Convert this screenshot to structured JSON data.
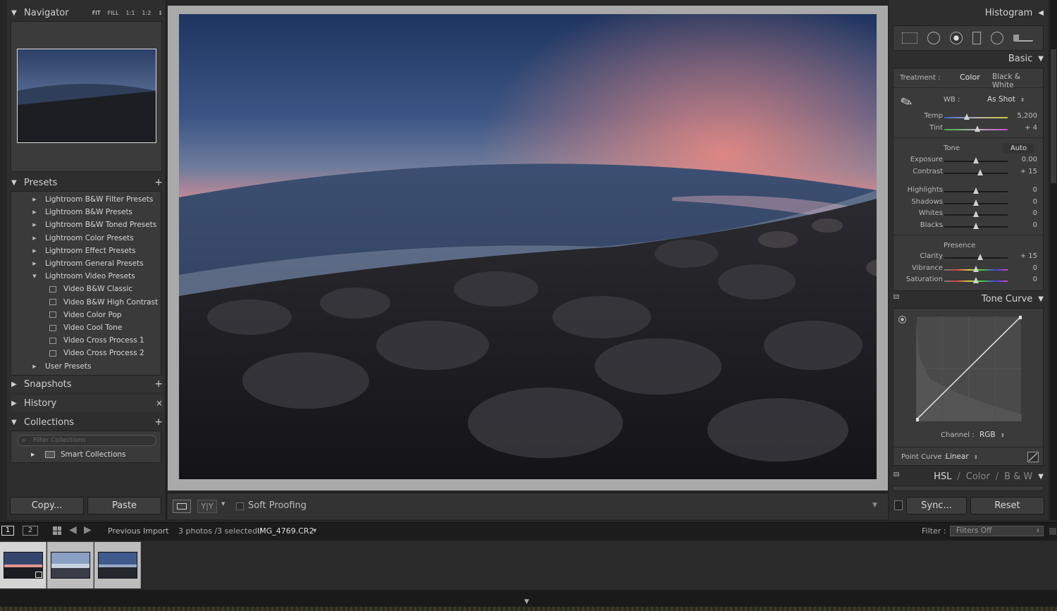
{
  "navigator": {
    "title": "Navigator",
    "zoom_options": [
      "FIT",
      "FILL",
      "1:1",
      "1:2"
    ]
  },
  "presets": {
    "title": "Presets",
    "items": [
      {
        "label": "Lightroom B&W Filter Presets",
        "type": "folder",
        "open": false
      },
      {
        "label": "Lightroom B&W Presets",
        "type": "folder",
        "open": false
      },
      {
        "label": "Lightroom B&W Toned Presets",
        "type": "folder",
        "open": false
      },
      {
        "label": "Lightroom Color Presets",
        "type": "folder",
        "open": false
      },
      {
        "label": "Lightroom Effect Presets",
        "type": "folder",
        "open": false
      },
      {
        "label": "Lightroom General Presets",
        "type": "folder",
        "open": false
      },
      {
        "label": "Lightroom Video Presets",
        "type": "folder",
        "open": true
      },
      {
        "label": "Video B&W Classic",
        "type": "preset"
      },
      {
        "label": "Video B&W High Contrast",
        "type": "preset"
      },
      {
        "label": "Video Color Pop",
        "type": "preset"
      },
      {
        "label": "Video Cool Tone",
        "type": "preset"
      },
      {
        "label": "Video Cross Process 1",
        "type": "preset"
      },
      {
        "label": "Video Cross Process 2",
        "type": "preset"
      },
      {
        "label": "User Presets",
        "type": "folder",
        "open": false
      }
    ]
  },
  "snapshots": {
    "title": "Snapshots"
  },
  "history": {
    "title": "History"
  },
  "collections": {
    "title": "Collections",
    "filter_placeholder": "Filter Collections",
    "smart": "Smart Collections"
  },
  "left_buttons": {
    "copy": "Copy...",
    "paste": "Paste"
  },
  "toolbar": {
    "soft_proofing": "Soft Proofing"
  },
  "histogram": {
    "title": "Histogram"
  },
  "basic": {
    "title": "Basic",
    "treatment_label": "Treatment :",
    "treatment_color": "Color",
    "treatment_bw": "Black & White",
    "wb_label": "WB :",
    "wb_value": "As Shot",
    "tone_label": "Tone",
    "auto": "Auto",
    "presence_label": "Presence",
    "sliders_wb": [
      {
        "label": "Temp",
        "value": "5,200",
        "pos": 0.35
      },
      {
        "label": "Tint",
        "value": "+ 4",
        "pos": 0.52
      }
    ],
    "sliders_tone": [
      {
        "label": "Exposure",
        "value": "0.00",
        "pos": 0.5
      },
      {
        "label": "Contrast",
        "value": "+ 15",
        "pos": 0.57
      }
    ],
    "sliders_tone2": [
      {
        "label": "Highlights",
        "value": "0",
        "pos": 0.5
      },
      {
        "label": "Shadows",
        "value": "0",
        "pos": 0.5
      },
      {
        "label": "Whites",
        "value": "0",
        "pos": 0.5
      },
      {
        "label": "Blacks",
        "value": "0",
        "pos": 0.5
      }
    ],
    "sliders_presence": [
      {
        "label": "Clarity",
        "value": "+ 15",
        "pos": 0.57
      },
      {
        "label": "Vibrance",
        "value": "0",
        "pos": 0.5
      },
      {
        "label": "Saturation",
        "value": "0",
        "pos": 0.5
      }
    ]
  },
  "tone_curve": {
    "title": "Tone Curve",
    "channel_label": "Channel :",
    "channel_value": "RGB",
    "point_curve_label": "Point Curve :",
    "point_curve_value": "Linear"
  },
  "hsl": {
    "hsl": "HSL",
    "sep": "/",
    "color": "Color",
    "bw": "B & W"
  },
  "right_buttons": {
    "sync": "Sync...",
    "reset": "Reset"
  },
  "filmstrip": {
    "page1": "1",
    "page2": "2",
    "source": "Previous Import",
    "count": "3 photos /3 selected /",
    "filename": "IMG_4769.CR2",
    "filter_label": "Filter :",
    "filter_value": "Filters Off"
  }
}
